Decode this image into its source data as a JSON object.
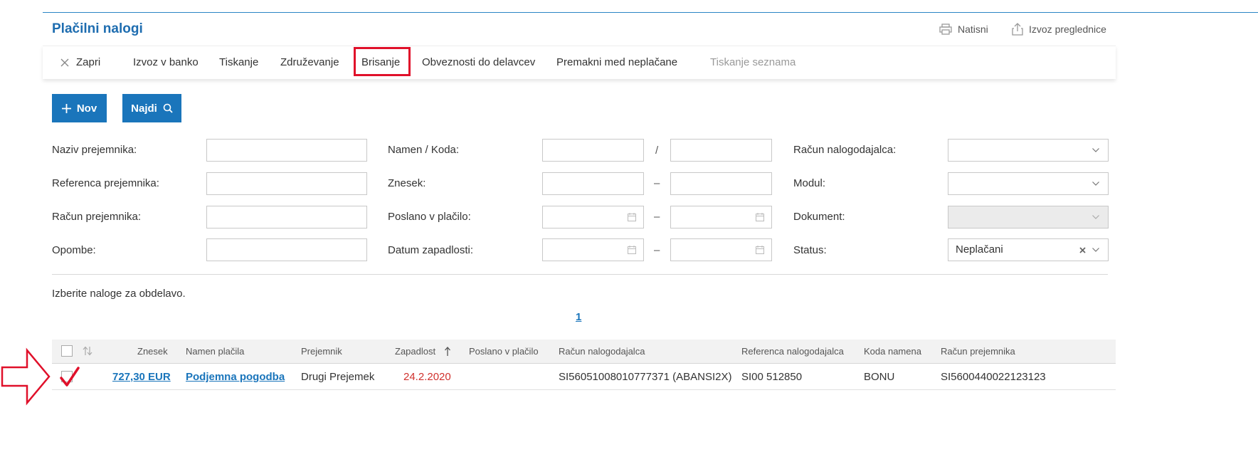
{
  "page": {
    "title": "Plačilni nalogi"
  },
  "top_actions": {
    "print": "Natisni",
    "export": "Izvoz preglednice"
  },
  "toolbar": {
    "close": "Zapri",
    "bank_export": "Izvoz v banko",
    "print": "Tiskanje",
    "merge": "Združevanje",
    "delete": "Brisanje",
    "employee_obligations": "Obveznosti do delavcev",
    "move_unpaid": "Premakni med neplačane",
    "print_list": "Tiskanje seznama"
  },
  "buttons": {
    "new": "Nov",
    "find": "Najdi"
  },
  "filters": {
    "recipient_name": "Naziv prejemnika:",
    "recipient_reference": "Referenca prejemnika:",
    "recipient_account": "Račun prejemnika:",
    "notes": "Opombe:",
    "purpose_code": "Namen / Koda:",
    "amount": "Znesek:",
    "sent_for_payment": "Poslano v plačilo:",
    "due_date": "Datum zapadlosti:",
    "payer_account": "Račun nalogodajalca:",
    "module": "Modul:",
    "document": "Dokument:",
    "status": "Status:",
    "status_value": "Neplačani",
    "slash": "/",
    "dash": "–"
  },
  "hint": "Izberite naloge za obdelavo.",
  "pagination": {
    "current": "1"
  },
  "table": {
    "headers": {
      "amount": "Znesek",
      "purpose": "Namen plačila",
      "recipient": "Prejemnik",
      "due": "Zapadlost",
      "sent": "Poslano v plačilo",
      "payer_account": "Račun nalogodajalca",
      "payer_reference": "Referenca nalogodajalca",
      "purpose_code": "Koda namena",
      "recipient_account": "Račun prejemnika"
    },
    "rows": [
      {
        "amount": "727,30 EUR",
        "purpose": "Podjemna pogodba",
        "recipient": "Drugi Prejemek",
        "due": "24.2.2020",
        "sent": "",
        "payer_account": "SI56051008010777371 (ABANSI2X)",
        "payer_reference": "SI00 512850",
        "purpose_code": "BONU",
        "recipient_account": "SI5600440022123123"
      }
    ]
  },
  "colors": {
    "accent": "#1a75bb",
    "title": "#1e6db0",
    "highlight": "#e0102a",
    "due_red": "#d0312d"
  },
  "icons": [
    "printer-icon",
    "export-icon",
    "close-icon",
    "plus-icon",
    "search-icon",
    "calendar-icon",
    "chevron-down-icon",
    "clear-icon",
    "sort-icon",
    "sort-up-icon",
    "arrow-annotation",
    "checkmark-annotation"
  ]
}
